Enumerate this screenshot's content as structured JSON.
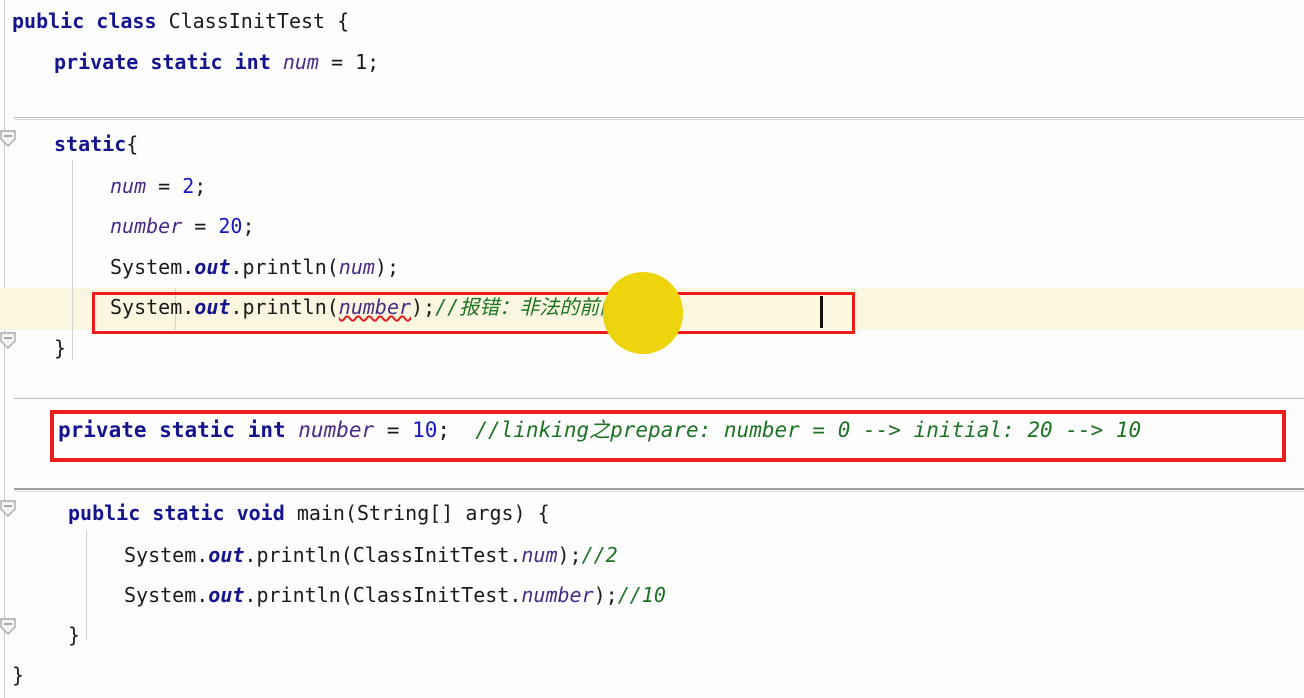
{
  "editor": {
    "language": "java",
    "class_name": "ClassInitTest",
    "colors": {
      "background": "#fdfdfd",
      "keyword": "#13148e",
      "field": "#4b2a86",
      "number": "#1616c8",
      "comment": "#1d7324",
      "current_line_highlight": "#fbf6df",
      "annotation_box": "#ef1b1b",
      "cursor_blob": "#eed40d",
      "error_squiggle": "#e02020",
      "gutter_line": "#c9c9c9",
      "separator": "#bdbdbd"
    }
  },
  "code": {
    "line1": {
      "kw_public": "public",
      "kw_class": "class",
      "class_name": "ClassInitTest",
      "brace": "{"
    },
    "line2": {
      "kw_private": "private",
      "kw_static": "static",
      "kw_int": "int",
      "field": "num",
      "eq": " = ",
      "value": "1",
      "semi": ";"
    },
    "line3": {
      "kw_static": "static",
      "brace": "{"
    },
    "line4": {
      "field": "num",
      "eq": " = ",
      "value": "2",
      "semi": ";"
    },
    "line5": {
      "field": "number",
      "eq": " = ",
      "value": "20",
      "semi": ";"
    },
    "line6": {
      "prefix": "System.",
      "out": "out",
      "mid": ".println(",
      "arg": "num",
      "suffix": ");"
    },
    "line7": {
      "prefix": "System.",
      "out": "out",
      "mid": ".println(",
      "arg": "number",
      "suffix": ");",
      "comment": "//报错：非法的前向引用。"
    },
    "line8": {
      "brace": "}"
    },
    "line9": {
      "kw_private": "private",
      "kw_static": "static",
      "kw_int": "int",
      "field": "number",
      "eq": " = ",
      "value": "10",
      "semi": ";",
      "comment": "//linking之prepare: number = 0 --> initial: 20 --> 10"
    },
    "line10": {
      "kw_public": "public",
      "kw_static": "static",
      "kw_void": "void",
      "name": "main(String[] args) ",
      "brace": "{"
    },
    "line11": {
      "prefix": "System.",
      "out": "out",
      "mid": ".println(ClassInitTest.",
      "arg": "num",
      "suffix": ");",
      "comment": "//2"
    },
    "line12": {
      "prefix": "System.",
      "out": "out",
      "mid": ".println(ClassInitTest.",
      "arg": "number",
      "suffix": ");",
      "comment": "//10"
    },
    "line13": {
      "brace": "}"
    },
    "line14": {
      "brace": "}"
    }
  }
}
